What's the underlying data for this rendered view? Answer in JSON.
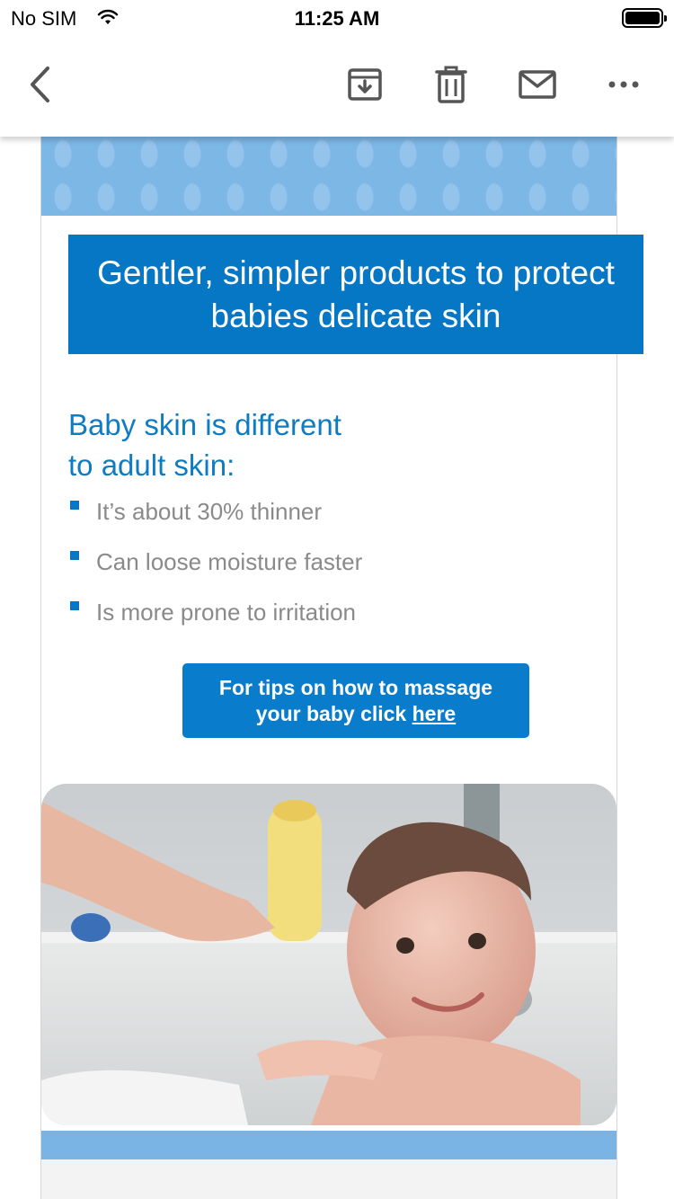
{
  "status_bar": {
    "carrier": "No SIM",
    "time": "11:25 AM"
  },
  "toolbar": {
    "back_icon": "chevron-left-icon",
    "archive_icon": "archive-icon",
    "delete_icon": "trash-icon",
    "mark_icon": "envelope-icon",
    "more_icon": "more-horizontal-icon"
  },
  "email": {
    "banner_text": "Gentler, simpler products to protect babies delicate skin",
    "heading_line1": "Baby skin is different",
    "heading_line2": "to adult skin:",
    "bullets": [
      "It’s about 30% thinner",
      "Can loose moisture faster",
      "Is more prone to irritation"
    ],
    "cta_line1": "For tips on how to massage",
    "cta_line2_prefix": "your baby click ",
    "cta_link": "here",
    "colors": {
      "brand_blue": "#0577c4",
      "heading_blue": "#0f7cc2",
      "pattern_blue": "#7db7e6",
      "bullet_text": "#8a8a8a"
    }
  }
}
